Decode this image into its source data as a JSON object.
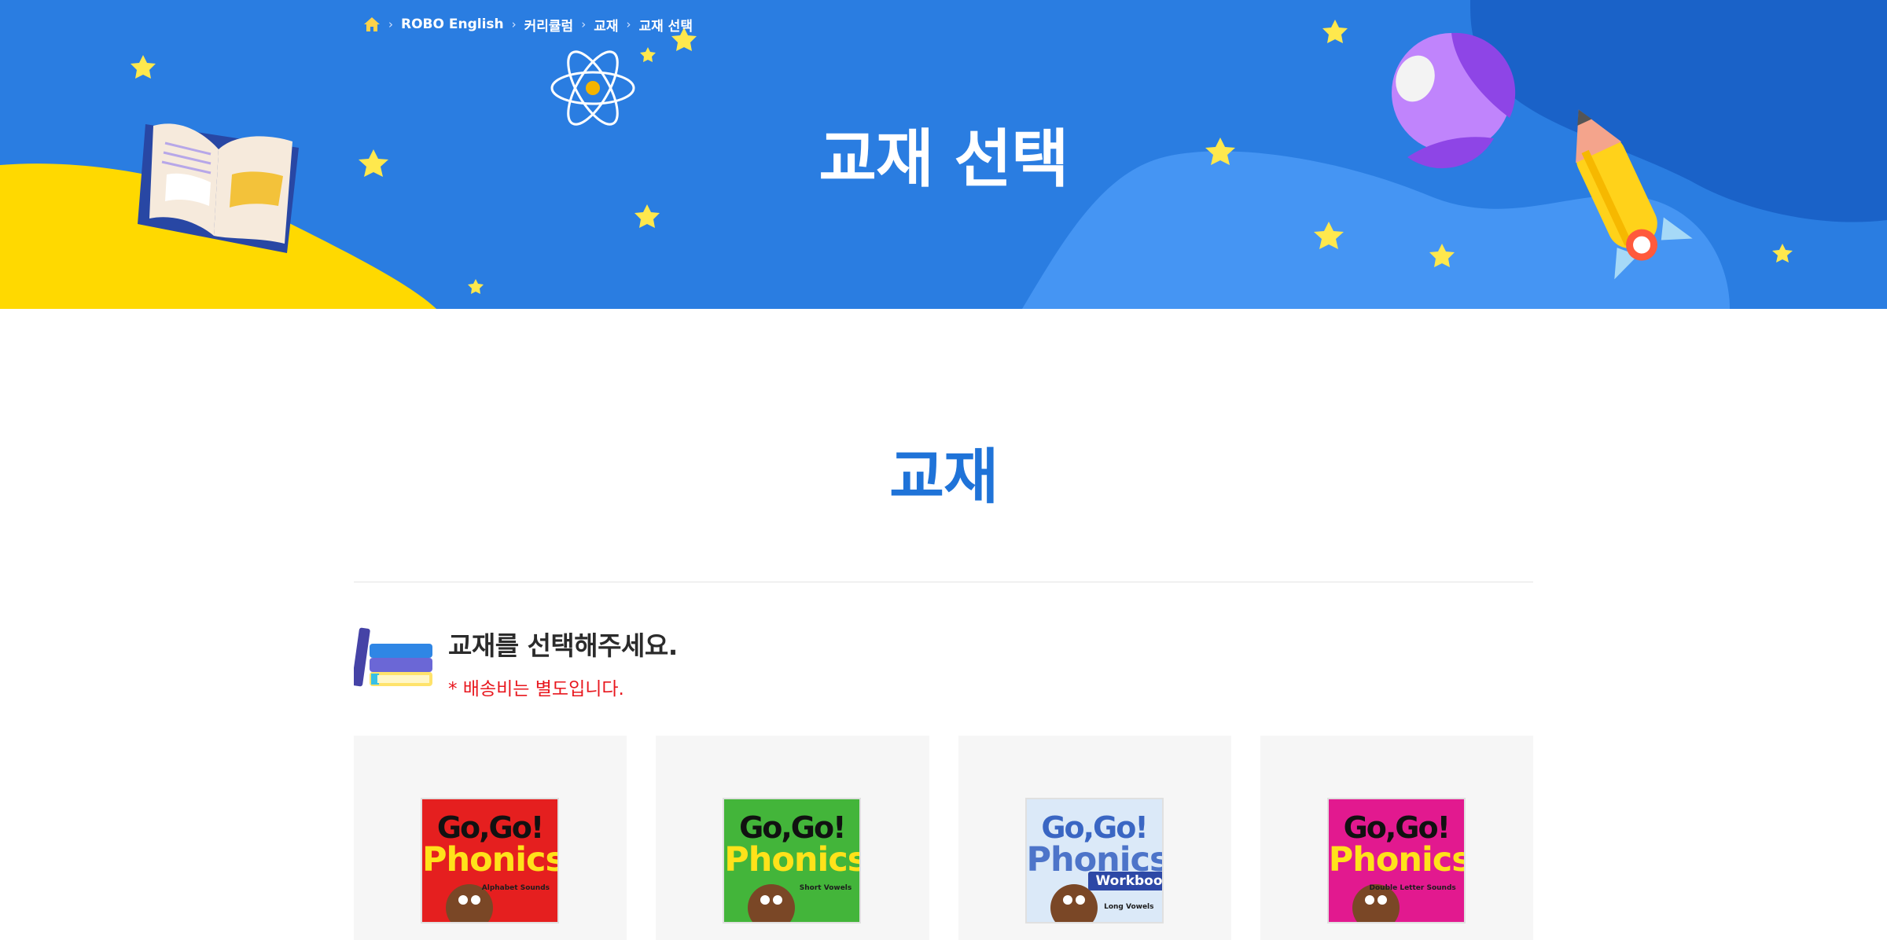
{
  "breadcrumb": {
    "home_icon": "home-icon",
    "separator": "›",
    "items": [
      "ROBO English",
      "커리큘럼",
      "교재",
      "교재 선택"
    ]
  },
  "hero": {
    "title": "교재 선택"
  },
  "section": {
    "title": "교재",
    "heading": "교재를 선택해주세요.",
    "note": "* 배송비는 별도입니다."
  },
  "books": [
    {
      "brand": "Go,Go!",
      "title": "Phonics",
      "subtitle": "Alphabet Sounds",
      "cover_color": "#e51f1f",
      "title_color": "#ffe21a",
      "brand_color": "#111111"
    },
    {
      "brand": "Go,Go!",
      "title": "Phonics",
      "subtitle": "Short Vowels",
      "cover_color": "#43b53a",
      "title_color": "#ffe21a",
      "brand_color": "#111111"
    },
    {
      "brand": "Go,Go!",
      "title": "Phonics",
      "subtitle": "Long Vowels",
      "tag": "Workbook",
      "cover_color": "#dbe9f8",
      "title_color": "#4d74c9",
      "brand_color": "#3a66c3"
    },
    {
      "brand": "Go,Go!",
      "title": "Phonics",
      "subtitle": "Double Letter Sounds",
      "cover_color": "#e2198f",
      "title_color": "#ffe21a",
      "brand_color": "#111111"
    }
  ],
  "colors": {
    "hero_bg": "#2a7de1",
    "accent_blue": "#1f73d8",
    "note_red": "#e8171e",
    "hill_yellow": "#ffd900"
  }
}
